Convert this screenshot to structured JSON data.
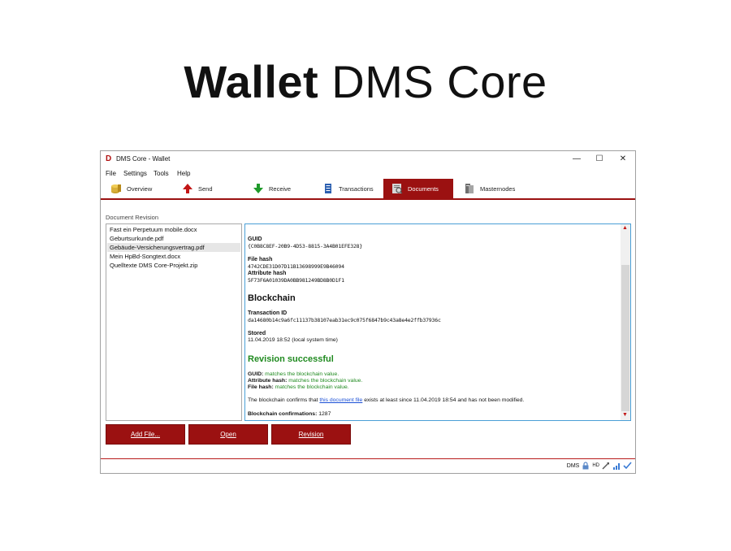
{
  "hero": {
    "bold": "Wallet",
    "light": "DMS Core"
  },
  "window": {
    "title": "DMS Core - Wallet",
    "logo": "D"
  },
  "menu": [
    "File",
    "Settings",
    "Tools",
    "Help"
  ],
  "tabs": [
    {
      "label": "Overview",
      "icon": "coins-icon"
    },
    {
      "label": "Send",
      "icon": "send-arrow-icon"
    },
    {
      "label": "Receive",
      "icon": "receive-arrow-icon"
    },
    {
      "label": "Transactions",
      "icon": "list-icon"
    },
    {
      "label": "Documents",
      "icon": "document-icon",
      "active": true
    },
    {
      "label": "Masternodes",
      "icon": "server-icon"
    }
  ],
  "documents": {
    "section_label": "Document Revision",
    "files": [
      "Fast ein Perpetuum mobile.docx",
      "Geburtsurkunde.pdf",
      "Gebäude-Versicherungsvertrag.pdf",
      "Mein HpBd-Songtext.docx",
      "Quelltexte DMS Core-Projekt.zip"
    ],
    "selected_index": 2
  },
  "detail": {
    "guid_label": "GUID",
    "guid_value": "{C0B8C8EF-20B9-4D53-8815-3A4B01EFE328}",
    "file_hash_label": "File hash",
    "file_hash_value": "4742CDE31D07D11B13698999E9B46094",
    "attribute_hash_label": "Attribute hash",
    "attribute_hash_value": "5F73F6A01039DA0BB981249BD8B0D1F1",
    "blockchain_heading": "Blockchain",
    "txid_label": "Transaction ID",
    "txid_value": "da14680b14c9a6fc11137b38107eab31ec9c075f6847b9c43a8e4e2ffb37936c",
    "stored_label": "Stored",
    "stored_value": "11.04.2019 18:52 (local system time)",
    "revision_heading": "Revision successful",
    "guid_match_label": "GUID:",
    "guid_match_text": "matches the blockchain value.",
    "attr_match_label": "Attribute hash:",
    "attr_match_text": "matches the blockchain value.",
    "file_match_label": "File hash:",
    "file_match_text": "matches the blockchain value.",
    "confirm_prefix": "The blockchain confirms that",
    "confirm_link": "this document file",
    "confirm_suffix": "exists at least since 11.04.2019 18:54 and has not been modified.",
    "confirmations_label": "Blockchain confirmations:",
    "confirmations_value": "1287"
  },
  "buttons": {
    "add": "Add File...",
    "open": "Open",
    "revision": "Revision"
  },
  "statusbar": {
    "unit": "DMS",
    "hd": "HD"
  },
  "colors": {
    "accent": "#9b1111",
    "success": "#1f8a1f",
    "link": "#1a4fd6"
  }
}
